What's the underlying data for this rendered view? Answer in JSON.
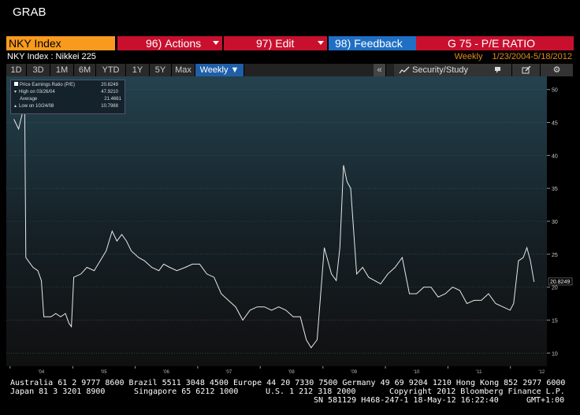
{
  "window": {
    "grab_label": "GRAB"
  },
  "command_bar": {
    "ticker": "NKY Index",
    "actions": {
      "num": "96)",
      "label": "Actions"
    },
    "edit": {
      "num": "97)",
      "label": "Edit"
    },
    "feedback": {
      "num": "98)",
      "label": "Feedback"
    },
    "function_title": "G 75 - P/E RATIO"
  },
  "subtitle": {
    "security": "NKY Index : Nikkei 225",
    "frequency": "Weekly",
    "date_range": "1/23/2004-5/18/2012"
  },
  "toolbar": {
    "periods": [
      "1D",
      "3D",
      "1M",
      "6M",
      "YTD",
      "1Y",
      "5Y",
      "Max"
    ],
    "frequency_select": "Weekly ▼",
    "collapse": "«",
    "security_study": "Security/Study"
  },
  "legend": {
    "rows": [
      {
        "label": "Price Earnings Ratio (P/E)",
        "value": "20.8249"
      },
      {
        "label": "High on 03/26/04",
        "value": "47.9210"
      },
      {
        "label": "Average",
        "value": "21.4661"
      },
      {
        "label": "Low on 10/24/08",
        "value": "10.7988"
      }
    ]
  },
  "chart_data": {
    "type": "line",
    "title": "",
    "xlabel": "",
    "ylabel": "",
    "ylim": [
      8,
      52
    ],
    "y_ticks": [
      "50",
      "45",
      "40",
      "35",
      "30",
      "25",
      "20",
      "15",
      "10"
    ],
    "x_tick_labels": [
      "'04",
      "'05",
      "'06",
      "'07",
      "'08",
      "'09",
      "'10",
      "'11",
      "'12"
    ],
    "last_value_label": "20.8249",
    "grid": true,
    "series": [
      {
        "x": [
          "2004-01-23",
          "2004-02-20",
          "2004-03-26",
          "2004-04-02",
          "2004-04-16",
          "2004-05-14",
          "2004-06-11",
          "2004-07-02",
          "2004-07-16",
          "2004-08-27",
          "2004-09-24",
          "2004-10-22",
          "2004-11-19",
          "2004-12-10",
          "2004-12-24",
          "2005-01-07",
          "2005-02-18",
          "2005-03-25",
          "2005-05-06",
          "2005-06-10",
          "2005-07-15",
          "2005-08-19",
          "2005-09-16",
          "2005-10-14",
          "2005-11-11",
          "2005-12-09",
          "2006-01-20",
          "2006-02-24",
          "2006-04-07",
          "2006-05-19",
          "2006-06-16",
          "2006-07-21",
          "2006-09-01",
          "2006-10-20",
          "2006-12-01",
          "2007-01-12",
          "2007-02-23",
          "2007-04-06",
          "2007-05-18",
          "2007-06-29",
          "2007-08-10",
          "2007-09-21",
          "2007-11-02",
          "2007-12-14",
          "2008-01-25",
          "2008-03-07",
          "2008-04-18",
          "2008-05-30",
          "2008-07-11",
          "2008-08-22",
          "2008-09-26",
          "2008-10-24",
          "2008-11-28",
          "2009-01-09",
          "2009-02-20",
          "2009-03-20",
          "2009-04-10",
          "2009-05-01",
          "2009-05-22",
          "2009-06-12",
          "2009-07-17",
          "2009-08-21",
          "2009-09-25",
          "2009-10-30",
          "2009-12-04",
          "2010-01-15",
          "2010-02-26",
          "2010-04-09",
          "2010-05-21",
          "2010-07-02",
          "2010-08-13",
          "2010-09-24",
          "2010-11-05",
          "2010-12-17",
          "2011-01-28",
          "2011-03-11",
          "2011-04-22",
          "2011-06-03",
          "2011-07-15",
          "2011-08-26",
          "2011-10-07",
          "2011-11-18",
          "2011-12-30",
          "2012-01-20",
          "2012-02-17",
          "2012-03-16",
          "2012-04-06",
          "2012-04-27",
          "2012-05-18"
        ],
        "y": [
          45.5,
          44,
          47.9,
          24.5,
          24,
          23,
          22.5,
          21,
          15.5,
          15.5,
          16,
          15.5,
          16,
          14.5,
          14,
          21.5,
          22,
          23,
          22.5,
          24,
          25.5,
          28.5,
          27,
          28,
          27,
          25.5,
          24.5,
          24,
          23,
          22.5,
          23.5,
          23,
          22.5,
          23,
          23.5,
          23.5,
          22,
          21.5,
          19,
          18,
          17,
          15,
          16.5,
          17,
          17,
          16.5,
          17,
          16.5,
          15.5,
          15.5,
          12,
          10.8,
          12,
          26,
          22,
          21,
          26,
          38.5,
          36,
          35,
          22,
          23,
          21.5,
          21,
          20.5,
          22,
          23,
          24.5,
          19,
          19,
          20,
          20,
          18.5,
          19,
          20,
          19.5,
          17.5,
          18,
          18,
          19,
          17.5,
          17,
          16.5,
          17.5,
          24,
          24.5,
          26,
          24,
          20.8
        ]
      }
    ]
  },
  "footer": {
    "line1": "Australia 61 2 9777 8600 Brazil 5511 3048 4500 Europe 44 20 7330 7500 Germany 49 69 9204 1210 Hong Kong 852 2977 6000",
    "line2a": "Japan 81 3 3201 8900",
    "line2b": "Singapore 65 6212 1000",
    "line2c": "U.S. 1 212 318 2000",
    "line2d": "Copyright 2012 Bloomberg Finance L.P.",
    "line3": "SN 581129 H468-247-1 18-May-12 16:22:40",
    "line3tz": "GMT+1:00"
  }
}
